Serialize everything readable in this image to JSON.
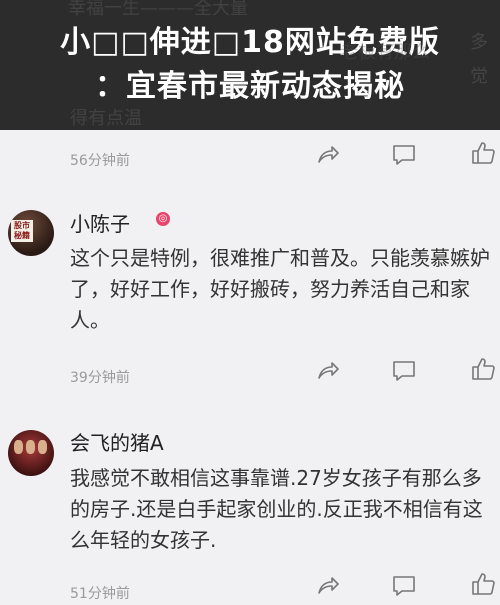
{
  "banner": {
    "line1": "小□□伸进□18网站免费版",
    "line2": "：宜春市最新动态揭秘"
  },
  "faint": {
    "top_name": "幸福一生———全大量",
    "top_text": "得有点温",
    "side_char1": "多",
    "side_char2": "觉",
    "hidden_text": "老板有那么"
  },
  "comments": [
    {
      "time": "56分钟前"
    },
    {
      "avatar_label": "股市\n秘籍",
      "user": "小陈子",
      "badge": "◎",
      "text": "这个只是特例，很难推广和普及。只能羡慕嫉妒了，好好工作，好好搬砖，努力养活自己和家人。",
      "time": "39分钟前"
    },
    {
      "user": "会飞的猪A",
      "text": "我感觉不敢相信这事靠谱.27岁女孩子有那么多的房子.还是白手起家创业的.反正我不相信有这么年轻的女孩子.",
      "time": "51分钟前"
    }
  ],
  "icons": [
    "share-icon",
    "comment-icon",
    "like-icon"
  ]
}
